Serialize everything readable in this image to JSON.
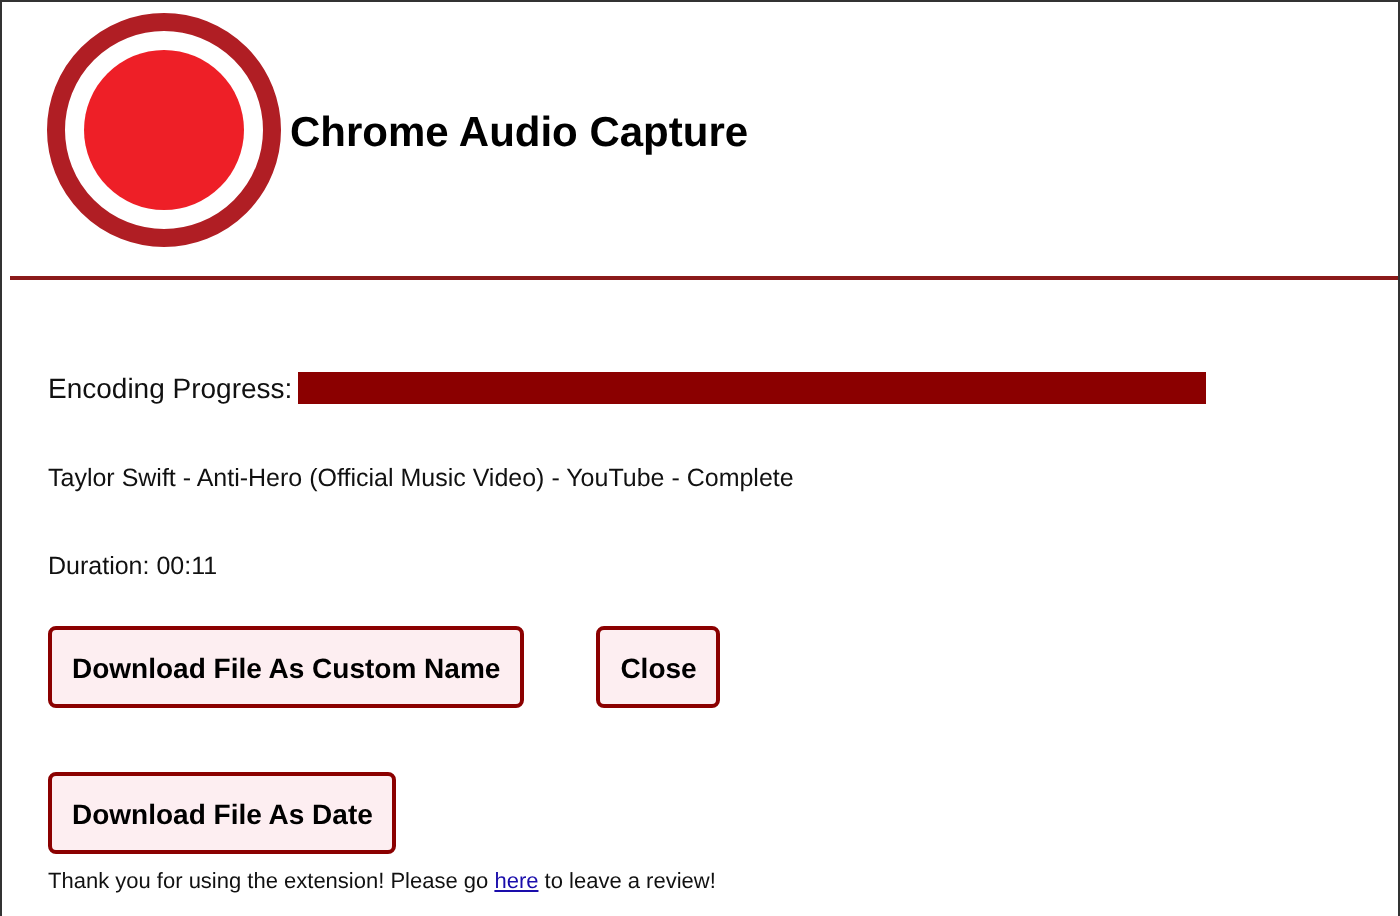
{
  "header": {
    "title": "Chrome Audio Capture"
  },
  "progress": {
    "label": "Encoding Progress:",
    "level": 1
  },
  "file_status": "Taylor Swift - Anti-Hero (Official Music Video) - YouTube - Complete",
  "duration": "Duration: 00:11",
  "button_rows": [
    [
      {
        "label": "Download File As Custom Name"
      },
      {
        "label": "Close"
      }
    ],
    [
      {
        "label": "Download File As Date"
      }
    ]
  ],
  "footer": {
    "before": "Thank you for using the extension! Please go ",
    "link": "here",
    "after": " to leave a review!"
  }
}
